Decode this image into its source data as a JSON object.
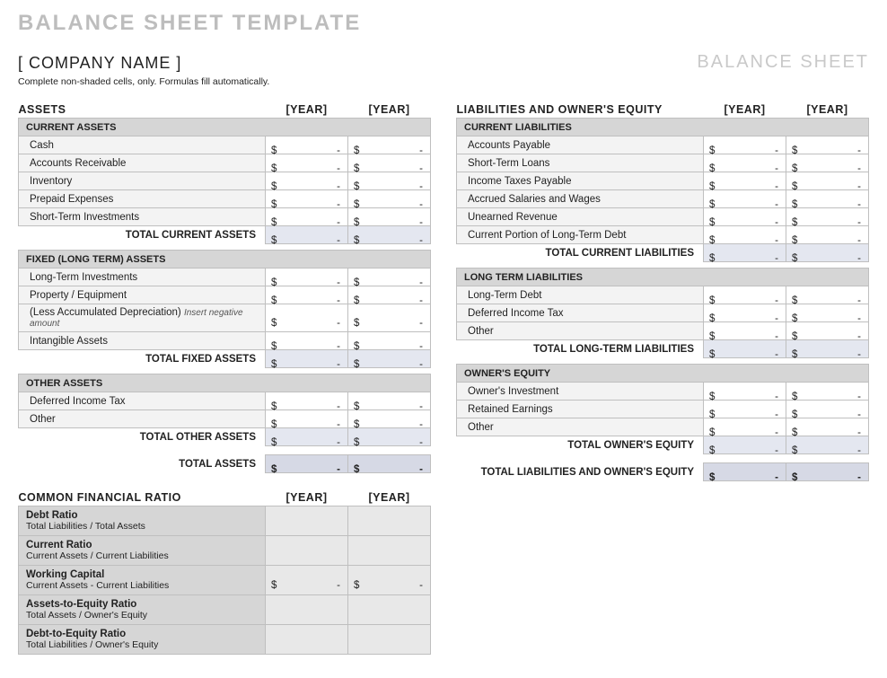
{
  "title": "BALANCE SHEET TEMPLATE",
  "company": "[ COMPANY NAME ]",
  "docLabel": "BALANCE SHEET",
  "instruction": "Complete non-shaded cells, only.  Formulas fill automatically.",
  "yearHeader": "[YEAR]",
  "currency": "$",
  "dash": "-",
  "assets": {
    "heading": "ASSETS",
    "current": {
      "heading": "CURRENT ASSETS",
      "items": [
        {
          "label": "Cash"
        },
        {
          "label": "Accounts Receivable"
        },
        {
          "label": "Inventory"
        },
        {
          "label": "Prepaid Expenses"
        },
        {
          "label": "Short-Term Investments"
        }
      ],
      "total": "TOTAL CURRENT ASSETS"
    },
    "fixed": {
      "heading": "FIXED (LONG TERM) ASSETS",
      "items": [
        {
          "label": "Long-Term Investments"
        },
        {
          "label": "Property / Equipment"
        },
        {
          "label": "(Less Accumulated Depreciation)",
          "note": "Insert negative amount"
        },
        {
          "label": "Intangible Assets"
        }
      ],
      "total": "TOTAL FIXED ASSETS"
    },
    "other": {
      "heading": "OTHER ASSETS",
      "items": [
        {
          "label": "Deferred Income Tax"
        },
        {
          "label": "Other"
        }
      ],
      "total": "TOTAL OTHER ASSETS"
    },
    "grandTotal": "TOTAL ASSETS"
  },
  "ratios": {
    "heading": "COMMON FINANCIAL RATIO",
    "items": [
      {
        "title": "Debt Ratio",
        "sub": "Total Liabilities / Total Assets",
        "showVal": false
      },
      {
        "title": "Current Ratio",
        "sub": "Current Assets / Current Liabilities",
        "showVal": false
      },
      {
        "title": "Working Capital",
        "sub": "Current Assets - Current Liabilities",
        "showVal": true
      },
      {
        "title": "Assets-to-Equity Ratio",
        "sub": "Total Assets / Owner's Equity",
        "showVal": false
      },
      {
        "title": "Debt-to-Equity Ratio",
        "sub": "Total Liabilities / Owner's Equity",
        "showVal": false
      }
    ]
  },
  "liab": {
    "heading": "LIABILITIES AND OWNER'S EQUITY",
    "current": {
      "heading": "CURRENT LIABILITIES",
      "items": [
        {
          "label": "Accounts Payable"
        },
        {
          "label": "Short-Term Loans"
        },
        {
          "label": "Income Taxes Payable"
        },
        {
          "label": "Accrued Salaries and Wages"
        },
        {
          "label": "Unearned Revenue"
        },
        {
          "label": "Current Portion of Long-Term Debt"
        }
      ],
      "total": "TOTAL CURRENT LIABILITIES"
    },
    "longterm": {
      "heading": "LONG TERM LIABILITIES",
      "items": [
        {
          "label": "Long-Term Debt"
        },
        {
          "label": "Deferred Income Tax"
        },
        {
          "label": "Other"
        }
      ],
      "total": "TOTAL LONG-TERM LIABILITIES"
    },
    "equity": {
      "heading": "OWNER'S EQUITY",
      "items": [
        {
          "label": "Owner's Investment"
        },
        {
          "label": "Retained Earnings"
        },
        {
          "label": "Other"
        }
      ],
      "total": "TOTAL OWNER'S EQUITY"
    },
    "grandTotal": "TOTAL LIABILITIES AND OWNER'S EQUITY"
  }
}
